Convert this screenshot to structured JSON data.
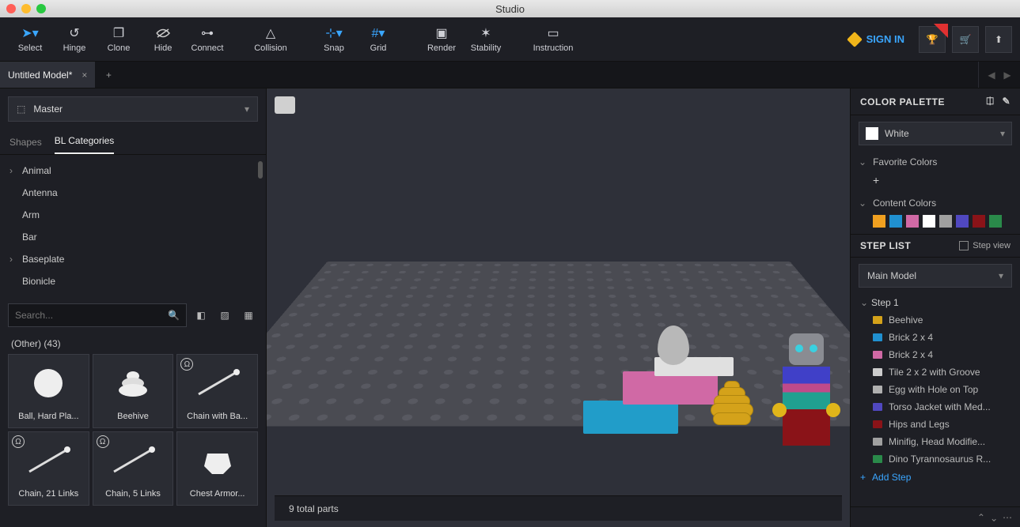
{
  "window": {
    "title": "Studio"
  },
  "toolbar": {
    "select": "Select",
    "hinge": "Hinge",
    "clone": "Clone",
    "hide": "Hide",
    "connect": "Connect",
    "collision": "Collision",
    "snap": "Snap",
    "grid": "Grid",
    "render": "Render",
    "stability": "Stability",
    "instruction": "Instruction",
    "signin": "SIGN IN"
  },
  "tabs": {
    "file": "Untitled Model*"
  },
  "modelSelect": "Master",
  "leftTabs": {
    "shapes": "Shapes",
    "bl": "BL Categories"
  },
  "categories": [
    "Animal",
    "Antenna",
    "Arm",
    "Bar",
    "Baseplate",
    "Bionicle"
  ],
  "categories_expandable": {
    "Animal": true,
    "Baseplate": true
  },
  "search": {
    "placeholder": "Search..."
  },
  "partsHeader": "(Other) (43)",
  "parts": [
    {
      "label": "Ball, Hard Pla...",
      "kind": "ball"
    },
    {
      "label": "Beehive",
      "kind": "beehive"
    },
    {
      "label": "Chain with Ba...",
      "kind": "chain1",
      "badge": true
    },
    {
      "label": "Chain, 21 Links",
      "kind": "chain2",
      "badge": true
    },
    {
      "label": "Chain, 5 Links",
      "kind": "chain3",
      "badge": true
    },
    {
      "label": "Chest Armor...",
      "kind": "armor"
    }
  ],
  "statusbar": "9 total parts",
  "colorPalette": {
    "header": "COLOR PALETTE",
    "current": "White",
    "currentHex": "#ffffff",
    "favHeader": "Favorite Colors",
    "contentHeader": "Content Colors",
    "contentColors": [
      "#f0a020",
      "#2090d0",
      "#d069a5",
      "#ffffff",
      "#a0a0a0",
      "#5048c0",
      "#8a1318",
      "#2a8a4a"
    ]
  },
  "stepList": {
    "header": "STEP LIST",
    "stepView": "Step view",
    "model": "Main Model",
    "step": "Step 1",
    "items": [
      {
        "color": "#d4a21a",
        "label": "Beehive"
      },
      {
        "color": "#2090d0",
        "label": "Brick 2 x 4"
      },
      {
        "color": "#d069a5",
        "label": "Brick 2 x 4"
      },
      {
        "color": "#cccccc",
        "label": "Tile 2 x 2 with Groove"
      },
      {
        "color": "#b0b0b0",
        "label": "Egg with Hole on Top"
      },
      {
        "color": "#5048c0",
        "label": "Torso Jacket with Med..."
      },
      {
        "color": "#8a1318",
        "label": "Hips and Legs"
      },
      {
        "color": "#a0a0a0",
        "label": "Minifig, Head Modifie..."
      },
      {
        "color": "#2a8a4a",
        "label": "Dino Tyrannosaurus R..."
      }
    ],
    "addStep": "Add Step"
  }
}
